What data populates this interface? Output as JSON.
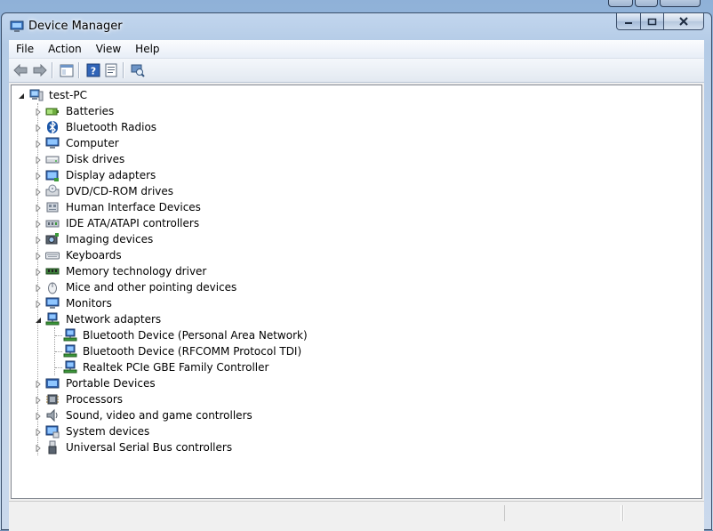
{
  "window": {
    "title": "Device Manager"
  },
  "menubar": {
    "items": [
      "File",
      "Action",
      "View",
      "Help"
    ]
  },
  "toolbar": {
    "buttons": [
      {
        "icon": "back-arrow-icon"
      },
      {
        "icon": "forward-arrow-icon"
      },
      {
        "icon": "show-hide-console-tree-icon"
      },
      {
        "icon": "help-icon"
      },
      {
        "icon": "properties-icon"
      },
      {
        "icon": "scan-hardware-icon"
      }
    ]
  },
  "tree": {
    "root": {
      "label": "test-PC",
      "expanded": true,
      "icon": "computer-icon"
    },
    "categories": [
      {
        "label": "Batteries",
        "icon": "battery-icon",
        "expanded": false
      },
      {
        "label": "Bluetooth Radios",
        "icon": "bluetooth-icon",
        "expanded": false
      },
      {
        "label": "Computer",
        "icon": "monitor-icon",
        "expanded": false
      },
      {
        "label": "Disk drives",
        "icon": "disk-drive-icon",
        "expanded": false
      },
      {
        "label": "Display adapters",
        "icon": "display-adapter-icon",
        "expanded": false
      },
      {
        "label": "DVD/CD-ROM drives",
        "icon": "dvd-drive-icon",
        "expanded": false
      },
      {
        "label": "Human Interface Devices",
        "icon": "hid-icon",
        "expanded": false
      },
      {
        "label": "IDE ATA/ATAPI controllers",
        "icon": "ide-controller-icon",
        "expanded": false
      },
      {
        "label": "Imaging devices",
        "icon": "camera-icon",
        "expanded": false
      },
      {
        "label": "Keyboards",
        "icon": "keyboard-icon",
        "expanded": false
      },
      {
        "label": "Memory technology driver",
        "icon": "memory-icon",
        "expanded": false
      },
      {
        "label": "Mice and other pointing devices",
        "icon": "mouse-icon",
        "expanded": false
      },
      {
        "label": "Monitors",
        "icon": "monitor-icon",
        "expanded": false
      },
      {
        "label": "Network adapters",
        "icon": "network-adapter-icon",
        "expanded": true,
        "children": [
          {
            "label": "Bluetooth Device (Personal Area Network)",
            "icon": "network-adapter-icon"
          },
          {
            "label": "Bluetooth Device (RFCOMM Protocol TDI)",
            "icon": "network-adapter-icon"
          },
          {
            "label": "Realtek PCIe GBE Family Controller",
            "icon": "network-adapter-icon"
          }
        ]
      },
      {
        "label": "Portable Devices",
        "icon": "portable-device-icon",
        "expanded": false
      },
      {
        "label": "Processors",
        "icon": "processor-icon",
        "expanded": false
      },
      {
        "label": "Sound, video and game controllers",
        "icon": "speaker-icon",
        "expanded": false
      },
      {
        "label": "System devices",
        "icon": "system-device-icon",
        "expanded": false
      },
      {
        "label": "Universal Serial Bus controllers",
        "icon": "usb-icon",
        "expanded": false
      }
    ]
  },
  "statusbar": {
    "text": ""
  }
}
